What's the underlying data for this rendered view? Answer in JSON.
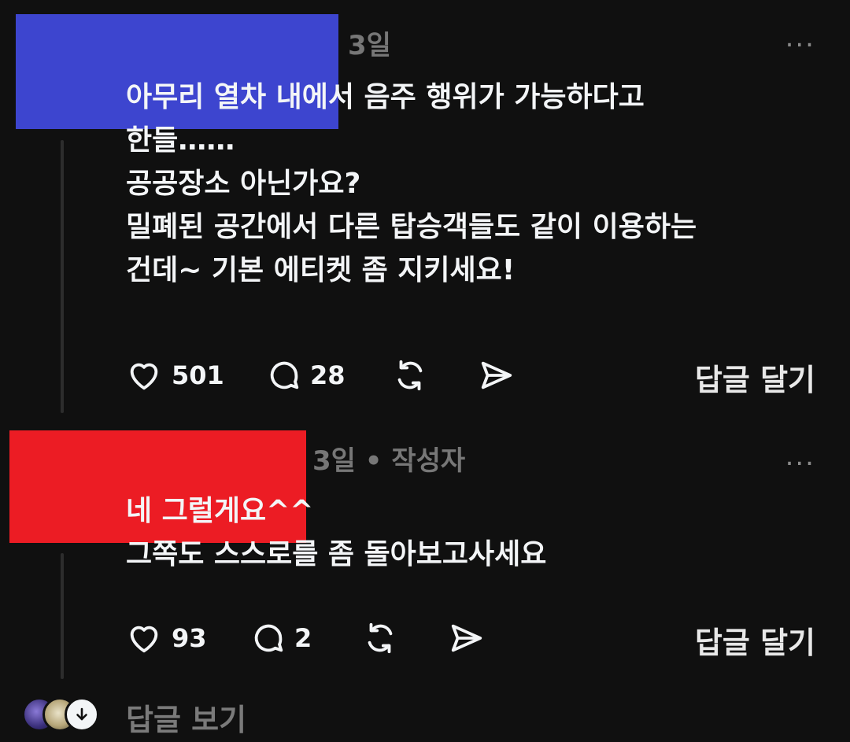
{
  "comment1": {
    "time": "3일",
    "more": "...",
    "text": "아무리 열차 내에서 음주 행위가 가능하다고\n한들……\n공공장소 아닌가요?\n밀폐된 공간에서 다른 탑승객들도 같이 이용하는\n건데~ 기본 에티켓 좀 지키세요!",
    "likes": "501",
    "comments": "28",
    "reply_label": "답글 달기"
  },
  "comment2": {
    "time": "3일 • 작성자",
    "more": "...",
    "text": "네 그럴게요^^\n그쪽도 스스로를 좀 돌아보고사세요",
    "likes": "93",
    "comments": "2",
    "reply_label": "답글 달기"
  },
  "footer": {
    "view_replies": "답글 보기"
  },
  "icons": {
    "like": "heart-icon",
    "comment": "speech-bubble-icon",
    "repost": "repost-icon",
    "share": "send-icon",
    "more": "more-dots-icon",
    "expand": "arrow-down-icon"
  },
  "colors": {
    "background": "#101010",
    "redaction_blue": "#3d45cf",
    "redaction_red": "#ec1c24",
    "muted_text": "#777777"
  }
}
